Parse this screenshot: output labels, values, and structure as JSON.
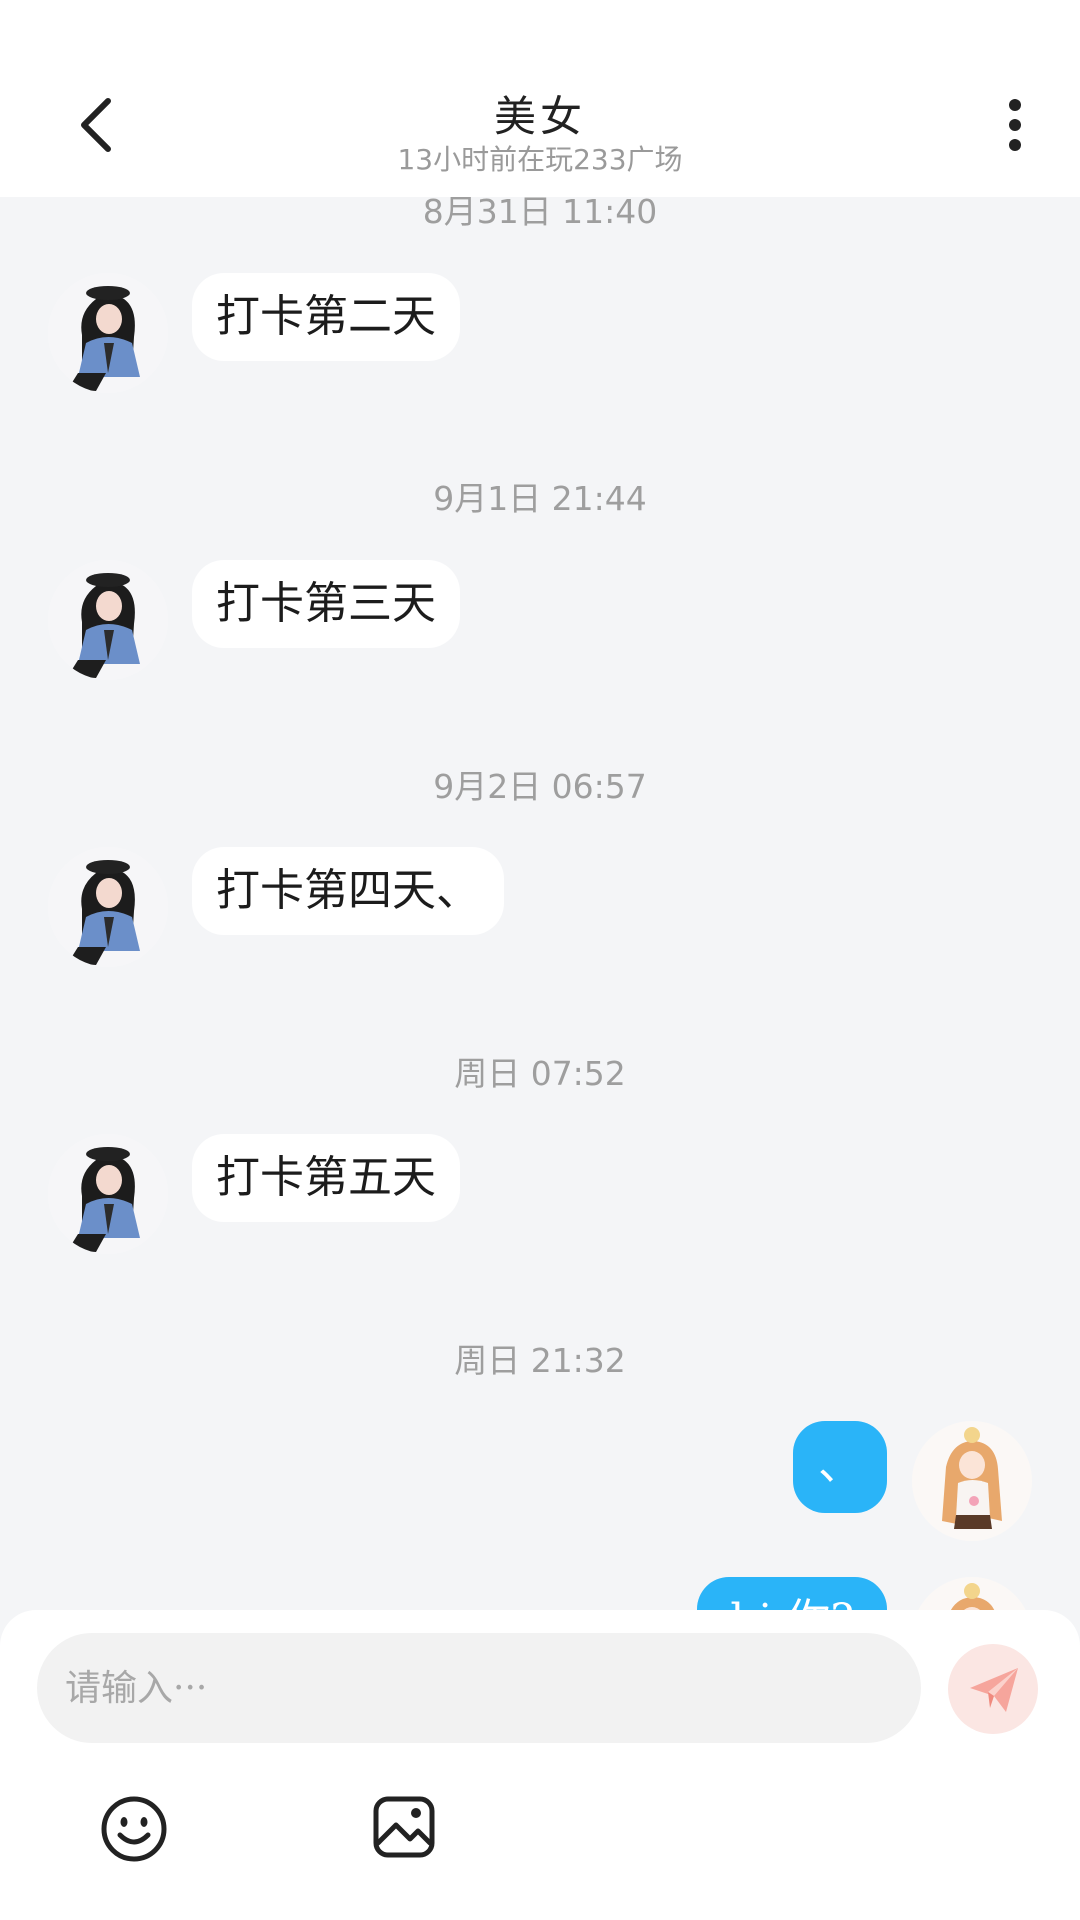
{
  "header": {
    "title": "美女",
    "subtitle": "13小时前在玩233广场",
    "back_icon": "chevron-left-icon",
    "more_icon": "more-vertical-icon"
  },
  "messages": [
    {
      "time": "8月31日 11:40",
      "text": "打卡第二天",
      "from": "other"
    },
    {
      "time": "9月1日 21:44",
      "text": "打卡第三天",
      "from": "other"
    },
    {
      "time": "9月2日 06:57",
      "text": "打卡第四天、",
      "from": "other"
    },
    {
      "time": "周日 07:52",
      "text": "打卡第五天",
      "from": "other"
    },
    {
      "time": "周日 21:32",
      "text": "、",
      "from": "me"
    },
    {
      "text": "hi 你?",
      "from": "me"
    }
  ],
  "input": {
    "placeholder": "请输入···",
    "value": ""
  },
  "toolbar": {
    "send_icon": "send-icon",
    "emoji_icon": "emoji-icon",
    "image_icon": "image-icon"
  },
  "colors": {
    "chat_background": "#f4f5f7",
    "my_bubble": "#2ab4f8",
    "other_bubble": "#ffffff",
    "send_button": "#fbe6e3",
    "send_icon": "#f6a59c"
  }
}
